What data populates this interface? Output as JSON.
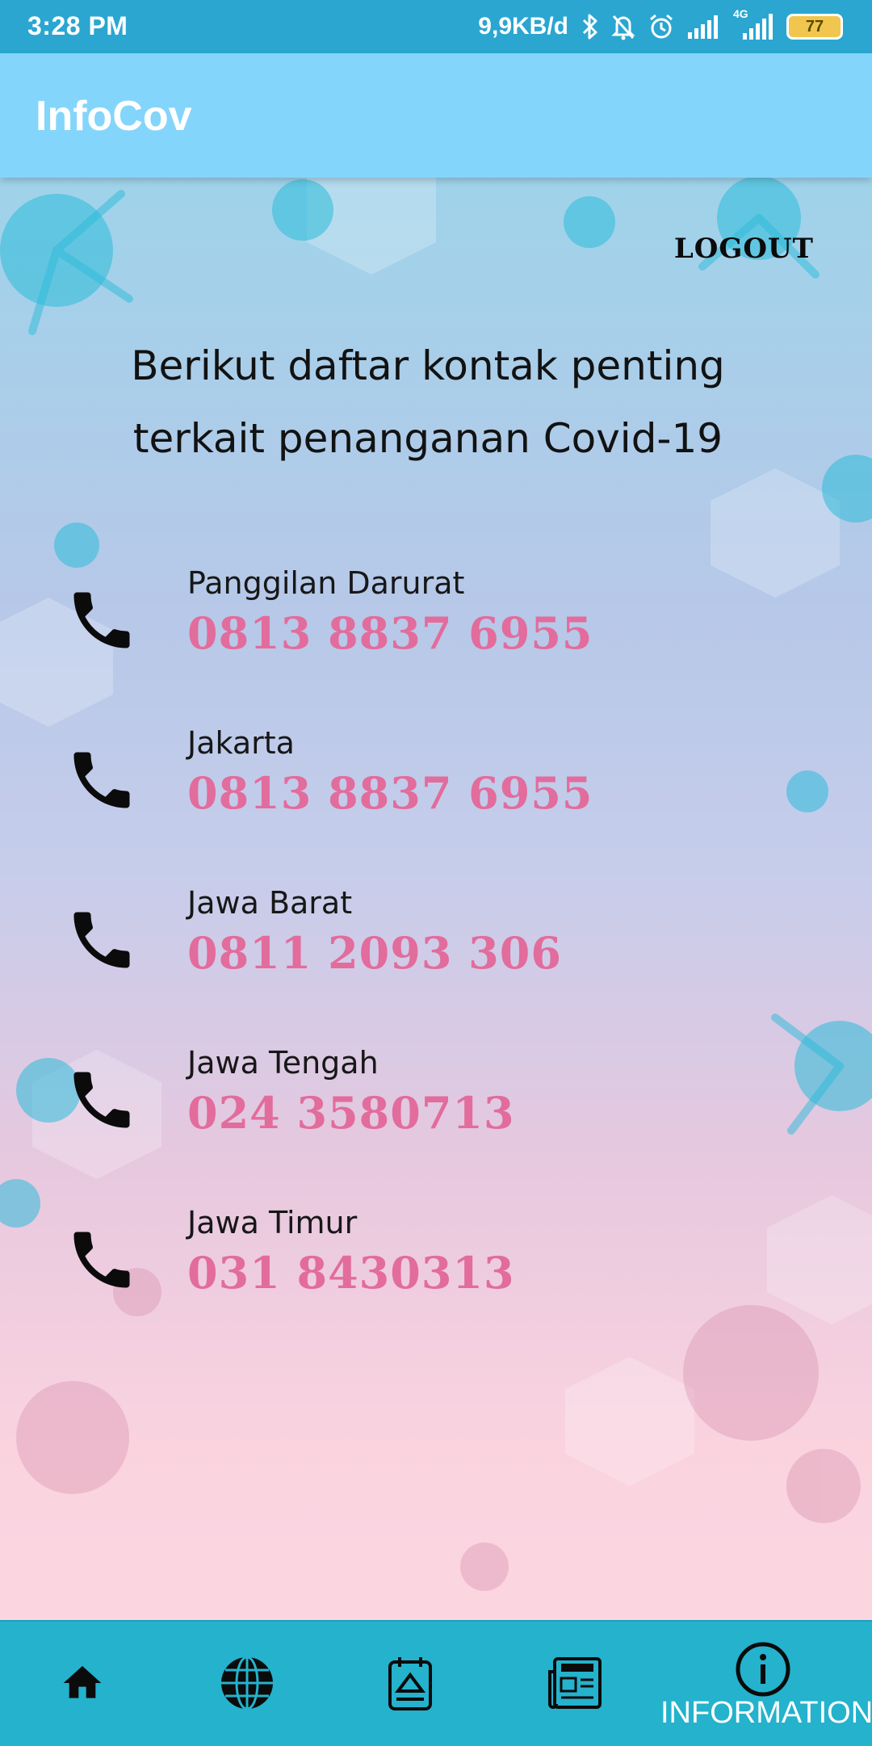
{
  "status_bar": {
    "time": "3:28 PM",
    "network_speed": "9,9KB/d",
    "signal_label": "4G",
    "battery_level": "77"
  },
  "app_bar": {
    "title": "InfoCov"
  },
  "main": {
    "logout_label": "LOGOUT",
    "intro_line1": "Berikut daftar kontak penting",
    "intro_line2": "terkait penanganan Covid-19",
    "contacts": [
      {
        "region": "Panggilan Darurat",
        "number": "0813 8837 6955"
      },
      {
        "region": "Jakarta",
        "number": "0813 8837 6955"
      },
      {
        "region": "Jawa Barat",
        "number": "0811 2093 306"
      },
      {
        "region": "Jawa Tengah",
        "number": "024 3580713"
      },
      {
        "region": "Jawa Timur",
        "number": "031 8430313"
      }
    ]
  },
  "bottom_nav": {
    "items": [
      {
        "icon": "home-icon"
      },
      {
        "icon": "globe-icon"
      },
      {
        "icon": "calendar-icon"
      },
      {
        "icon": "news-icon"
      },
      {
        "icon": "info-icon",
        "label": "INFORMATION",
        "active": true
      }
    ]
  },
  "colors": {
    "status_bar": "#2aa6d1",
    "app_bar": "#84d5fb",
    "bottom_nav": "#24b2cd",
    "phone_number": "#e26c9c",
    "battery": "#f0c64f"
  }
}
